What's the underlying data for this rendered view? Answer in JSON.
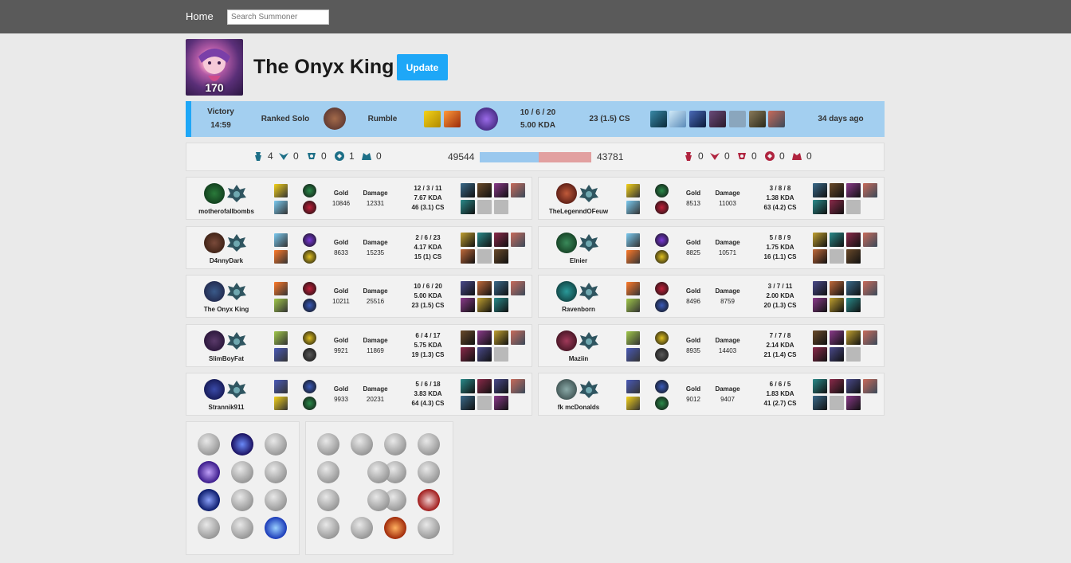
{
  "nav": {
    "home": "Home",
    "search_placeholder": "Search Summoner"
  },
  "summoner": {
    "name": "The Onyx King",
    "level": "170",
    "update_label": "Update"
  },
  "match": {
    "result": "Victory",
    "duration": "14:59",
    "queue": "Ranked Solo",
    "champion": "Rumble",
    "score": "10 / 6 / 20",
    "kda": "5.00 KDA",
    "cs": "23 (1.5) CS",
    "ago": "34 days ago"
  },
  "teams": {
    "blue": {
      "towers": "4",
      "inhibitors": "0",
      "barons": "0",
      "dragons": "1",
      "heralds": "0",
      "gold": "49544"
    },
    "red": {
      "towers": "0",
      "inhibitors": "0",
      "barons": "0",
      "dragons": "0",
      "heralds": "0",
      "gold": "43781"
    },
    "blue_gold_fraction": 0.531
  },
  "labels": {
    "gold": "Gold",
    "damage": "Damage"
  },
  "players_left": [
    {
      "name": "motherofallbombs",
      "gold": "10846",
      "damage": "12331",
      "score": "12 / 3 / 11",
      "kda": "7.67 KDA",
      "cs": "46 (3.1) CS"
    },
    {
      "name": "D4nnyDark",
      "gold": "8633",
      "damage": "15235",
      "score": "2 / 6 / 23",
      "kda": "4.17 KDA",
      "cs": "15 (1) CS"
    },
    {
      "name": "The Onyx King",
      "gold": "10211",
      "damage": "25516",
      "score": "10 / 6 / 20",
      "kda": "5.00 KDA",
      "cs": "23 (1.5) CS"
    },
    {
      "name": "SlimBoyFat",
      "gold": "9921",
      "damage": "11869",
      "score": "6 / 4 / 17",
      "kda": "5.75 KDA",
      "cs": "19 (1.3) CS"
    },
    {
      "name": "Strannik911",
      "gold": "9933",
      "damage": "20231",
      "score": "5 / 6 / 18",
      "kda": "3.83 KDA",
      "cs": "64 (4.3) CS"
    }
  ],
  "players_right": [
    {
      "name": "TheLegenndOFeuw",
      "gold": "8513",
      "damage": "11003",
      "score": "3 / 8 / 8",
      "kda": "1.38 KDA",
      "cs": "63 (4.2) CS"
    },
    {
      "name": "Elnier",
      "gold": "8825",
      "damage": "10571",
      "score": "5 / 8 / 9",
      "kda": "1.75 KDA",
      "cs": "16 (1.1) CS"
    },
    {
      "name": "Ravenborn",
      "gold": "8496",
      "damage": "8759",
      "score": "3 / 7 / 11",
      "kda": "2.00 KDA",
      "cs": "20 (1.3) CS"
    },
    {
      "name": "Maziin",
      "gold": "8935",
      "damage": "14403",
      "score": "7 / 7 / 8",
      "kda": "2.14 KDA",
      "cs": "21 (1.4) CS"
    },
    {
      "name": "fk mcDonalds",
      "gold": "9012",
      "damage": "9407",
      "score": "6 / 6 / 5",
      "kda": "1.83 KDA",
      "cs": "41 (2.7) CS"
    }
  ],
  "colors": {
    "accent": "#1ea7f7",
    "match_bg": "#a3cff0",
    "blue_team": "#1d6f87",
    "red_team": "#b0243f"
  }
}
